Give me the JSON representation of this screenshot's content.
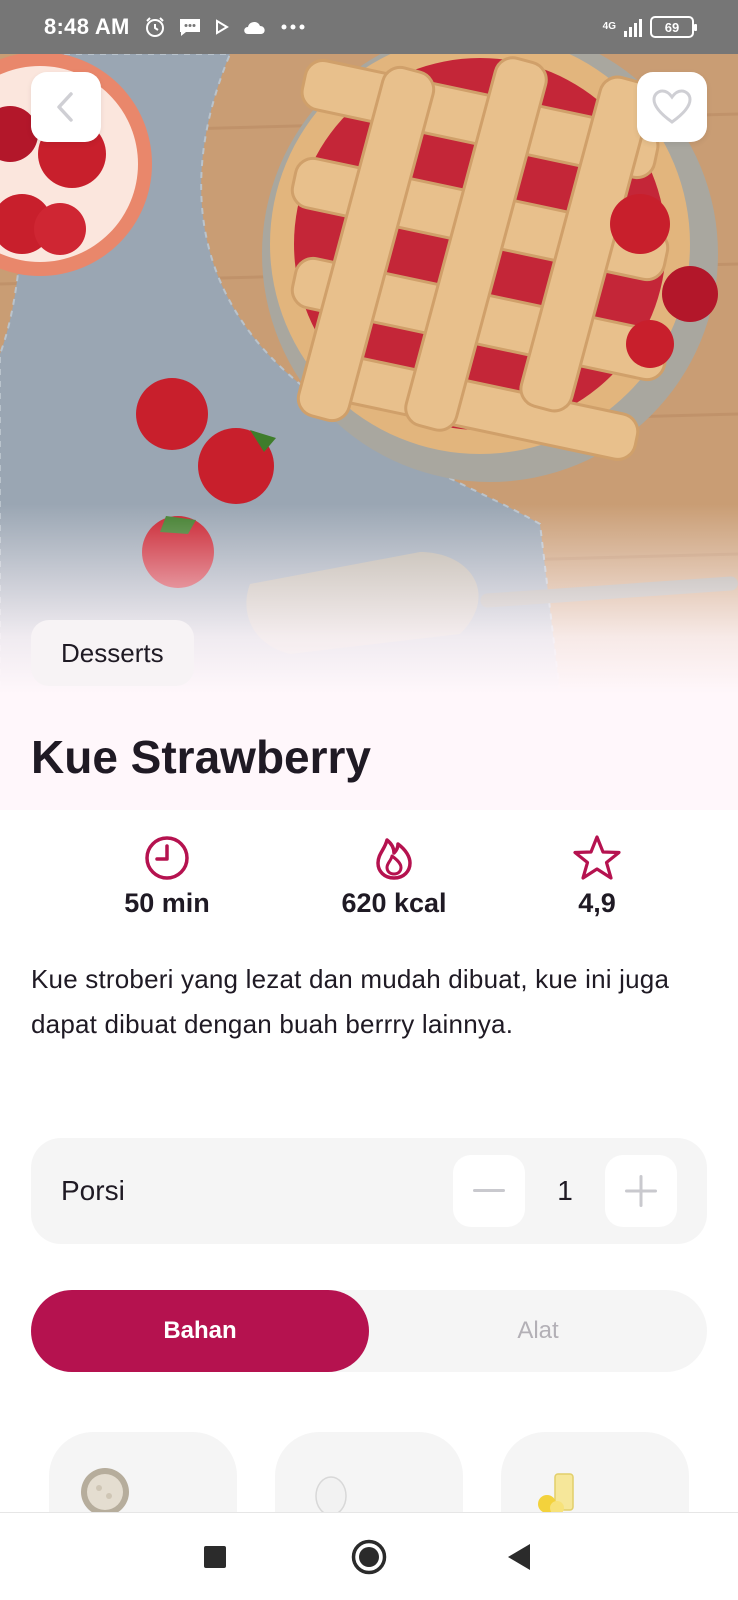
{
  "status_bar": {
    "time": "8:48 AM",
    "network": "4G",
    "battery": "69",
    "icons": [
      "alarm-icon",
      "message-icon",
      "play-icon",
      "cloud-icon",
      "more-icon"
    ]
  },
  "recipe": {
    "category": "Desserts",
    "title": "Kue Strawberry",
    "is_favorite": false,
    "stats": [
      {
        "icon": "clock-icon",
        "value": "50 min"
      },
      {
        "icon": "fire-icon",
        "value": "620 kcal"
      },
      {
        "icon": "star-icon",
        "value": "4,9"
      }
    ],
    "description": "Kue stroberi yang lezat dan mudah dibuat, kue ini juga dapat dibuat dengan buah berrry lainnya."
  },
  "portion": {
    "label": "Porsi",
    "value": "1"
  },
  "tabs": [
    {
      "label": "Bahan",
      "active": true
    },
    {
      "label": "Alat",
      "active": false
    }
  ],
  "ingredients": [
    {
      "icon": "flour-icon"
    },
    {
      "icon": "egg-icon"
    },
    {
      "icon": "lemonade-icon"
    }
  ],
  "colors": {
    "accent": "#b5124f",
    "title_band": "#fff7fb",
    "surface": "#f5f5f5"
  }
}
